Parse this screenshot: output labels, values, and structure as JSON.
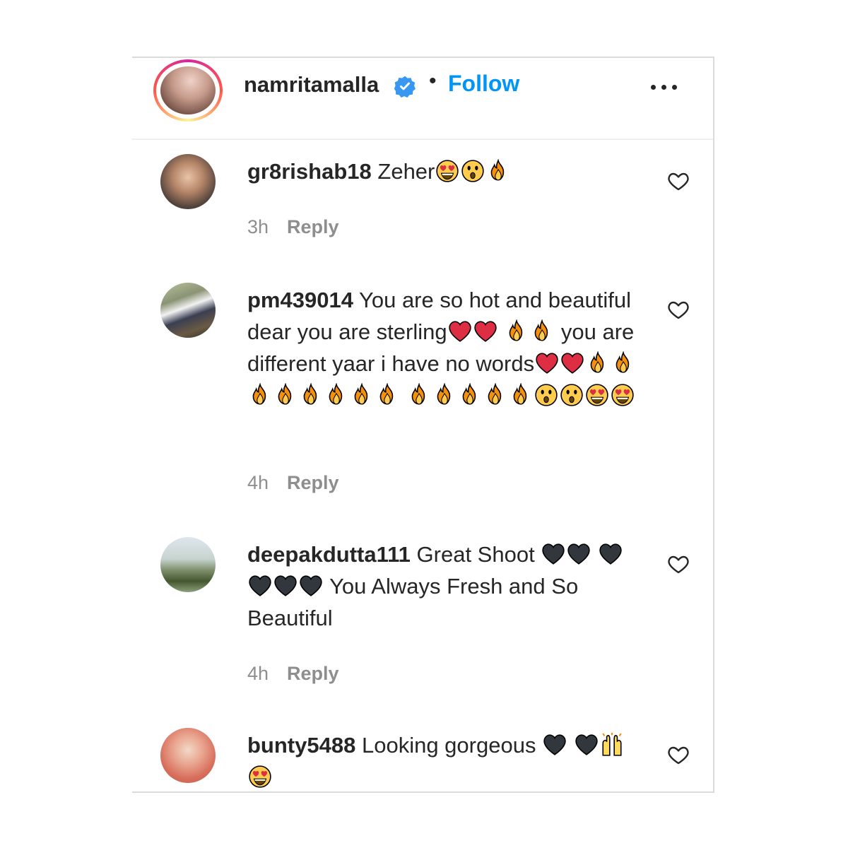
{
  "post": {
    "username": "namritamalla",
    "separator": "•",
    "follow_label": "Follow"
  },
  "comments": [
    {
      "username": "gr8rishab18",
      "lines": [
        {
          "text": "Zeher",
          "emojis": [
            "heart-eyes",
            "hushed",
            "fire"
          ]
        }
      ],
      "time": "3h",
      "reply_label": "Reply"
    },
    {
      "username": "pm439014",
      "lines": [
        {
          "text": "You are so hot and beautiful dear you are sterling",
          "emojis": [
            "red-heart",
            "red-heart",
            "fire",
            "fire"
          ]
        },
        {
          "text": "you are different yaar i have no words",
          "emojis": [
            "red-heart",
            "red-heart",
            "fire",
            "fire",
            "fire",
            "fire",
            "fire",
            "fire",
            "fire",
            "fire",
            "fire",
            "fire",
            "fire",
            "fire",
            "fire",
            "hushed",
            "hushed",
            "heart-eyes",
            "heart-eyes"
          ]
        }
      ],
      "time": "4h",
      "reply_label": "Reply"
    },
    {
      "username": "deepakdutta111",
      "lines": [
        {
          "text": "Great Shoot",
          "emojis": [
            "black-heart",
            "black-heart",
            "black-heart",
            "black-heart",
            "black-heart",
            "black-heart"
          ]
        },
        {
          "text": "You Always Fresh and So Beautiful",
          "emojis": []
        }
      ],
      "time": "4h",
      "reply_label": "Reply"
    },
    {
      "username": "bunty5488",
      "lines": [
        {
          "text": "Looking gorgeous",
          "emojis": [
            "black-heart",
            "black-heart",
            "raising-hands",
            "heart-eyes"
          ]
        }
      ],
      "time": "",
      "reply_label": ""
    }
  ],
  "icons": {
    "verified": "verified-badge-icon",
    "more": "more-options-icon",
    "like": "heart-outline-icon"
  },
  "colors": {
    "follow": "#0095f6",
    "verified": "#3897f0",
    "meta": "#8e8e8e"
  }
}
